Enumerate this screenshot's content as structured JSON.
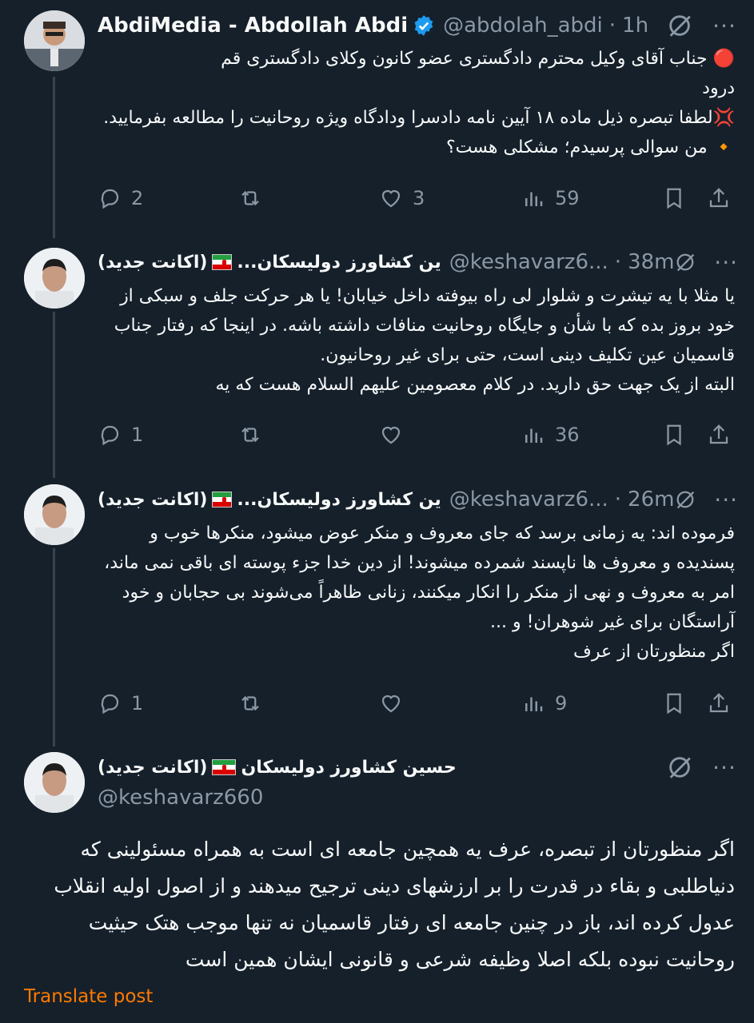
{
  "posts": [
    {
      "name": "AbdiMedia - Abdollah Abdi",
      "handle": "@abdolah_abdi",
      "time": "1h",
      "lines": [
        "🔴 جناب آقای وکیل محترم دادگستری عضو کانون وکلای دادگستری قم",
        "درود",
        "💢لطفا تبصره ذیل ماده ۱۸ آیین نامه دادسرا ودادگاه ویژه روحانیت را مطالعه بفرمایید.",
        "🔸 من سوالی پرسیدم؛ مشکلی هست؟"
      ],
      "replies": "2",
      "retweets": "",
      "likes": "3",
      "views": "59"
    },
    {
      "name_prefix": "...ین کشاورز دولیسکان",
      "name_suffix": "(اکانت جدید)",
      "handle": "@keshavarz6...",
      "time": "38m",
      "lines": [
        "یا مثلا با یه تیشرت و شلوار لی راه بیوفته داخل خیابان! یا هر حرکت جلف و سبکی از",
        "خود بروز بده که با شأن و جایگاه روحانیت منافات داشته باشه. در اینجا که رفتار جناب",
        "قاسمیان عین تکلیف دینی است، حتی برای غیر روحانیون.",
        "البته از یک جهت حق دارید. در کلام معصومین علیهم السلام هست که یه"
      ],
      "replies": "1",
      "retweets": "",
      "likes": "",
      "views": "36"
    },
    {
      "name_prefix": "...ین کشاورز دولیسکان",
      "name_suffix": "(اکانت جدید)",
      "handle": "@keshavarz6...",
      "time": "26m",
      "lines": [
        "فرموده اند: یه زمانی برسد که جای معروف و منکر عوض میشود، منکرها خوب و",
        "پسندیده و معروف ها ناپسند شمرده میشوند! از دین خدا جزء پوسته ای باقی نمی ماند،",
        "امر به معروف و نهی از منکر را انکار میکنند، زنانی ظاهراً می‌شوند بی حجابان و خود",
        "آراستگان برای غیر شوهران! و ...",
        "اگر منظورتان از عرف"
      ],
      "replies": "1",
      "retweets": "",
      "likes": "",
      "views": "9"
    },
    {
      "name_prefix": "حسین کشاورز دولیسکان",
      "name_suffix": "(اکانت جدید)",
      "handle": "@keshavarz660",
      "lines": [
        "اگر منظورتان از تبصره، عرف یه همچین جامعه ای است به همراه مسئولینی که",
        "دنیاطلبی و بقاء در قدرت را بر ارزشهای دینی ترجیح میدهند و از اصول اولیه انقلاب",
        "عدول کرده اند، باز در چنین جامعه ای رفتار قاسمیان نه تنها موجب هتک حیثیت",
        "روحانیت نبوده بلکه اصلا وظیفه شرعی و قانونی ایشان همین است"
      ]
    }
  ],
  "translate_label": "Translate post",
  "more_label": "···",
  "dot": "·",
  "colors": {
    "background": "#15202b",
    "text": "#f7f9f9",
    "muted": "#8b98a5",
    "verified": "#1d9bf0",
    "translate": "#ff7a00"
  }
}
